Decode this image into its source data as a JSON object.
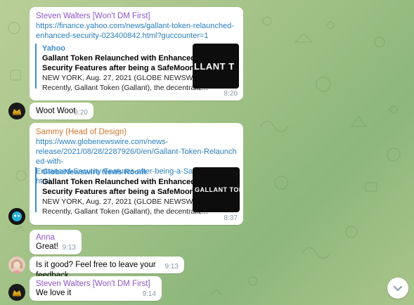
{
  "messages": [
    {
      "sender": "Steven Walters [Won't DM First]",
      "sender_color": "#8e56c9",
      "link": "https://finance.yahoo.com/news/gallant-token-relaunched-enhanced-security-023400842.html?guccounter=1",
      "link_line1": "https://finance.yahoo.com/news/gallant-token-relaunched-",
      "link_line2": "enhanced-security-023400842.html?guccounter=1",
      "preview": {
        "site": "Yahoo",
        "title_line1": "Gallant Token Relaunched with Enhanced",
        "title_line2": "Security Features after being a SafeMoon Fork",
        "desc_line1": "NEW YORK, Aug. 27, 2021 (GLOBE NEWSWIRE) --",
        "desc_line2": "Recently, Gallant Token (Gallant), the decentraliz...",
        "thumb_text": "LLANT T"
      },
      "time": "8:20"
    },
    {
      "text": "Woot Woot",
      "time": "8:20"
    },
    {
      "sender": "Sammy (Head of Design)",
      "sender_color": "#d2762f",
      "link_line1": "https://www.globenewswire.com/news-",
      "link_line2": "release/2021/08/28/2287926/0/en/Gallant-Token-Relaunched-with-",
      "link_line3": "Enhanced-Security-Features-after-being-a-SafeMoon-Fork.html",
      "preview": {
        "site": "GlobeNewswire News Room",
        "title_line1": "Gallant Token Relaunched with Enhanced",
        "title_line2": "Security Features after being a SafeMoon Fork",
        "desc_line1": "NEW YORK, Aug. 27, 2021 (GLOBE NEWSWIRE) --",
        "desc_line2": "Recently, Gallant Token (Gallant), the decentraliz...",
        "thumb_text": "GALLANT TOK"
      },
      "time": "8:37"
    },
    {
      "sender": "Anna",
      "sender_color": "#8e56c9",
      "text": "Great!",
      "time": "9:13"
    },
    {
      "text": "Is it good? Feel free to leave your feedback",
      "time": "9:13"
    },
    {
      "sender": "Steven Walters [Won't DM First]",
      "sender_color": "#8e56c9",
      "text": "We love it",
      "time": "9:14"
    }
  ],
  "icons": {
    "scroll_down": "chevron-down-icon"
  }
}
